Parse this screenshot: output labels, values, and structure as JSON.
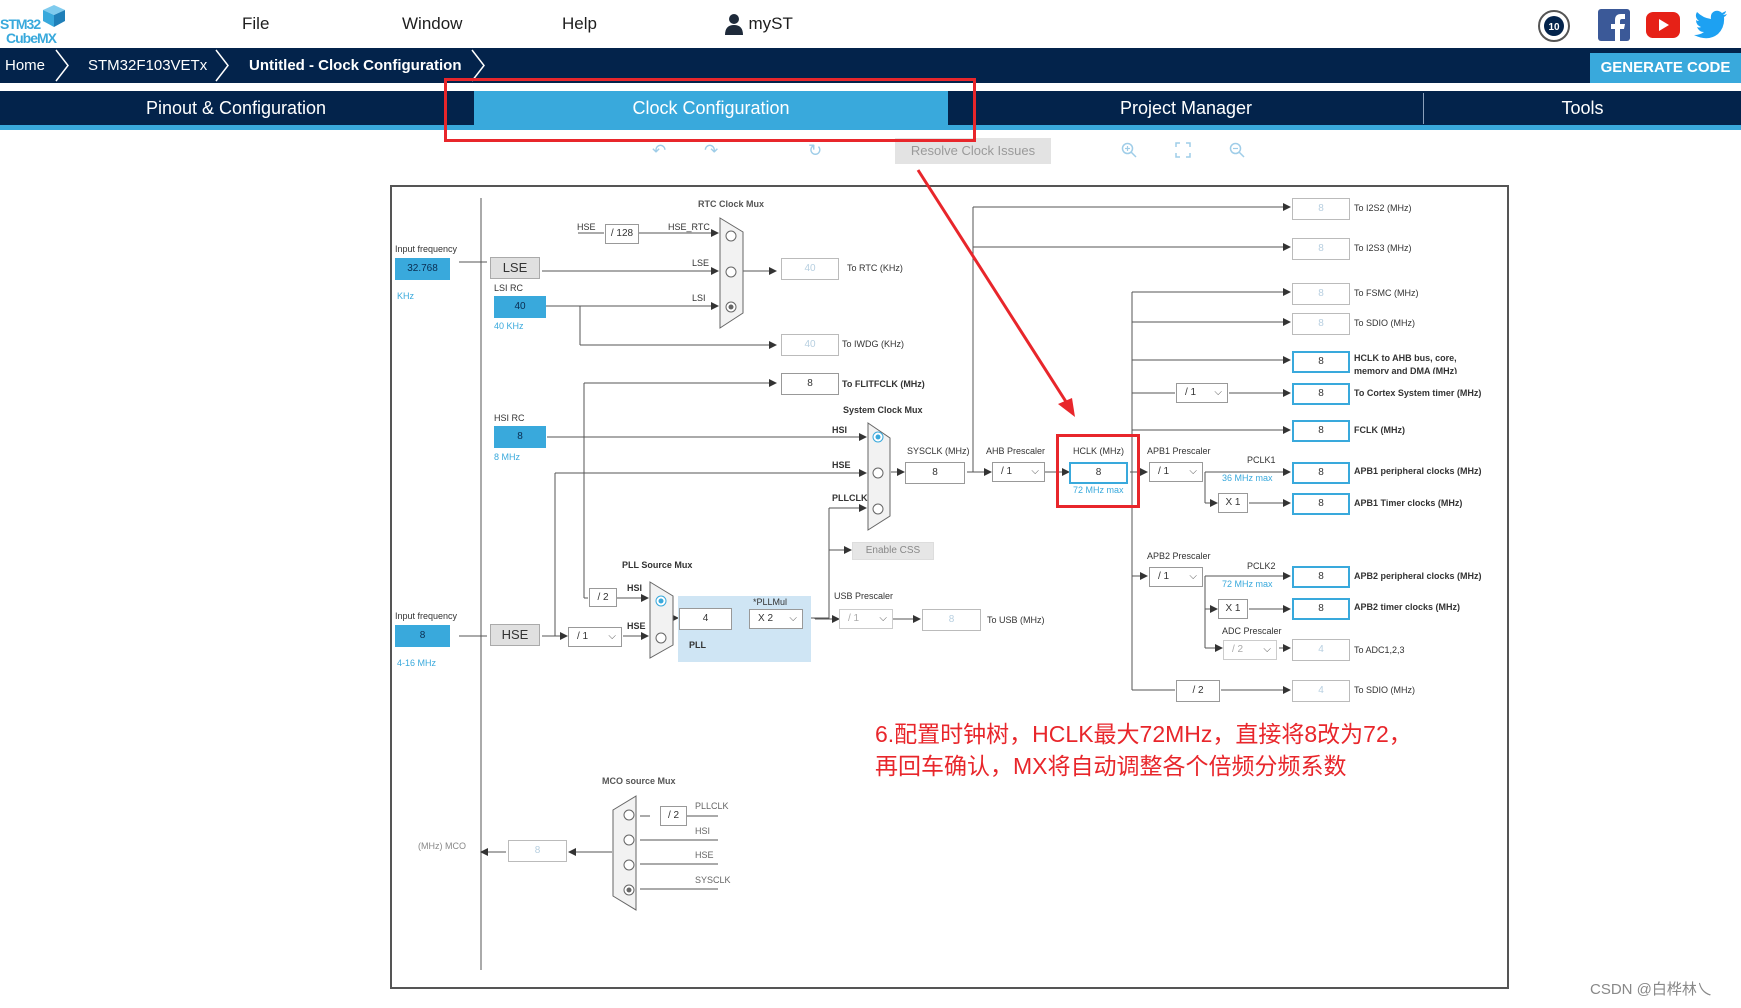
{
  "app": {
    "logo_text_1": "STM32",
    "logo_text_2": "CubeMX",
    "menu": [
      "File",
      "Window",
      "Help"
    ],
    "user_label": "myST",
    "social_icons": [
      "anniversary-badge-icon",
      "facebook-icon",
      "youtube-icon",
      "twitter-icon"
    ]
  },
  "breadcrumb": {
    "items": [
      "Home",
      "STM32F103VETx",
      "Untitled - Clock Configuration"
    ],
    "generate_label": "GENERATE CODE"
  },
  "tabs": [
    "Pinout & Configuration",
    "Clock Configuration",
    "Project Manager",
    "Tools"
  ],
  "toolbar": {
    "resolve_label": "Resolve Clock Issues",
    "icons": [
      "undo-icon",
      "redo-icon",
      "refresh-icon",
      "zoom-in-icon",
      "fit-screen-icon",
      "zoom-out-icon"
    ]
  },
  "clock": {
    "rtc_mux_title": "RTC Clock Mux",
    "hse_label": "HSE",
    "div128": "/ 128",
    "hse_rtc": "HSE_RTC",
    "lse_label": "LSE",
    "lsi_label": "LSI",
    "input_freq": "Input frequency",
    "lse_value": "32.768",
    "khz": "KHz",
    "lsi_rc": "LSI RC",
    "lsi_value": "40",
    "lsi_unit": "40 KHz",
    "rtc_value": "40",
    "rtc_label": "To RTC (KHz)",
    "iwdg_value": "40",
    "iwdg_label": "To IWDG (KHz)",
    "flit_value": "8",
    "flit_label": "To FLITFCLK (MHz)",
    "sys_mux_title": "System Clock Mux",
    "hsi_rc": "HSI RC",
    "hsi_value": "8",
    "hsi_unit": "8 MHz",
    "hsi_label": "HSI",
    "pllclk_label": "PLLCLK",
    "sysclk_label": "SYSCLK (MHz)",
    "sysclk_value": "8",
    "ahb_label": "AHB Prescaler",
    "ahb_value": "/ 1",
    "hclk_label": "HCLK (MHz)",
    "hclk_value": "8",
    "hclk_max": "72 MHz max",
    "enable_css": "Enable CSS",
    "pll_mux_title": "PLL Source Mux",
    "pll_div2": "/ 2",
    "pll_value": "4",
    "pllmul_label": "*PLLMul",
    "pllmul_value": "X 2",
    "pll_label": "PLL",
    "usb_prescaler": "USB Prescaler",
    "usb_div": "/ 1",
    "usb_value": "8",
    "usb_label": "To USB (MHz)",
    "hse_value": "8",
    "hse_unit": "4-16 MHz",
    "hse_prediv": "/ 1",
    "i2s2_value": "8",
    "i2s2_label": "To I2S2 (MHz)",
    "i2s3_value": "8",
    "i2s3_label": "To I2S3 (MHz)",
    "fsmc_value": "8",
    "fsmc_label": "To FSMC (MHz)",
    "sdio1_value": "8",
    "sdio1_label": "To SDIO (MHz)",
    "hclk_ahb_value": "8",
    "hclk_ahb_label_1": "HCLK to AHB bus, core,",
    "hclk_ahb_label_2": "memory and DMA (MHz)",
    "cortex_div": "/ 1",
    "cortex_value": "8",
    "cortex_label": "To Cortex System timer (MHz)",
    "fclk_value": "8",
    "fclk_label": "FCLK (MHz)",
    "apb1_label": "APB1 Prescaler",
    "apb1_value": "/ 1",
    "pclk1": "PCLK1",
    "pclk1_max": "36 MHz max",
    "apb1_periph_value": "8",
    "apb1_periph_label": "APB1 peripheral clocks (MHz)",
    "apb1_mul": "X 1",
    "apb1_timer_value": "8",
    "apb1_timer_label": "APB1 Timer clocks (MHz)",
    "apb2_label": "APB2 Prescaler",
    "apb2_value": "/ 1",
    "pclk2": "PCLK2",
    "pclk2_max": "72 MHz max",
    "apb2_periph_value": "8",
    "apb2_periph_label": "APB2 peripheral clocks (MHz)",
    "apb2_mul": "X 1",
    "apb2_timer_value": "8",
    "apb2_timer_label": "APB2 timer clocks (MHz)",
    "adc_prescaler": "ADC Prescaler",
    "adc_div": "/ 2",
    "adc_value": "4",
    "adc_label": "To ADC1,2,3",
    "sdio2_div": "/ 2",
    "sdio2_value": "4",
    "sdio2_label": "To SDIO (MHz)",
    "mco_mux_title": "MCO source Mux",
    "mco_pllclk": "PLLCLK",
    "mco_div2": "/ 2",
    "mco_hsi": "HSI",
    "mco_hse": "HSE",
    "mco_sysclk": "SYSCLK",
    "mco_label": "(MHz) MCO",
    "mco_value": "8"
  },
  "annotation": {
    "line1": "6.配置时钟树，HCLK最大72MHz，直接将8改为72，",
    "line2": "再回车确认，MX将自动调整各个倍频分频系数",
    "color": "#e8262b"
  },
  "watermark": "CSDN @白桦林乀"
}
